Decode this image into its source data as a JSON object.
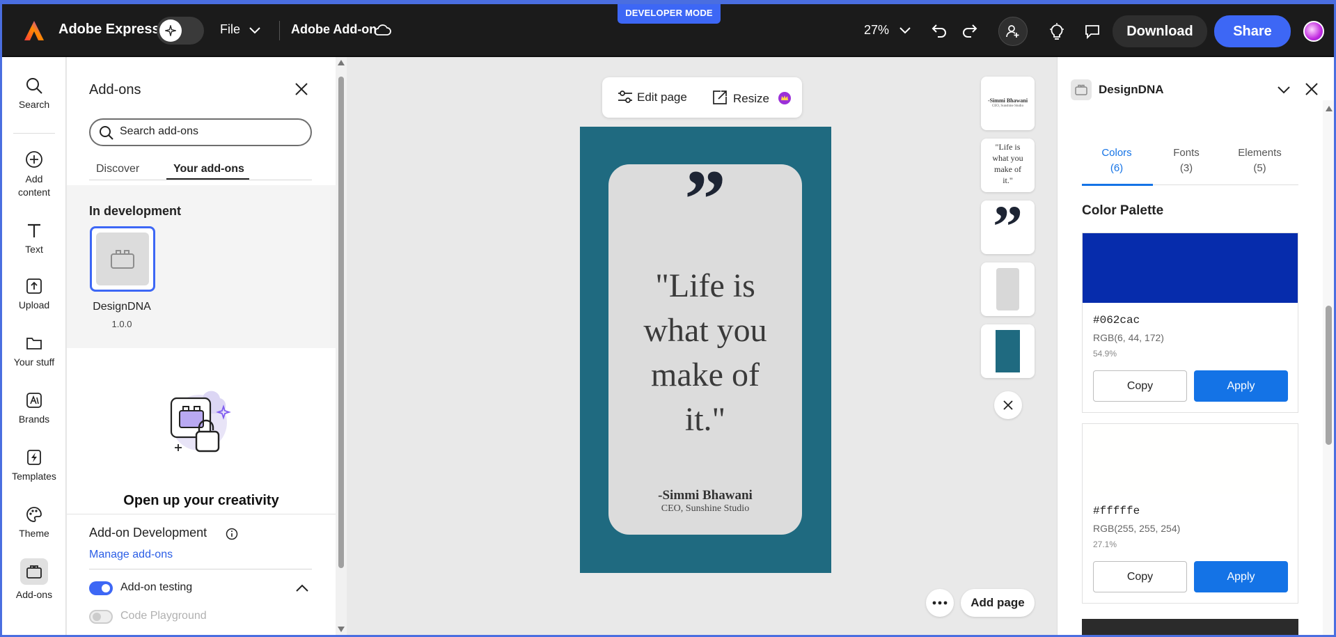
{
  "topbar": {
    "app_name": "Adobe Express",
    "file_menu": "File",
    "doc_title": "Adobe Add-on",
    "developer_badge": "DEVELOPER MODE",
    "zoom": "27%",
    "download_label": "Download",
    "share_label": "Share"
  },
  "rail": {
    "items": [
      {
        "label": "Search"
      },
      {
        "label": "Add content"
      },
      {
        "label": "Text"
      },
      {
        "label": "Upload"
      },
      {
        "label": "Your stuff"
      },
      {
        "label": "Brands"
      },
      {
        "label": "Templates"
      },
      {
        "label": "Theme"
      },
      {
        "label": "Add-ons"
      }
    ]
  },
  "addons": {
    "title": "Add-ons",
    "search_placeholder": "Search add-ons",
    "tabs": [
      "Discover",
      "Your add-ons"
    ],
    "in_dev_heading": "In development",
    "addon_name": "DesignDNA",
    "addon_version": "1.0.0",
    "promo_heading": "Open up your creativity",
    "dev_section_title": "Add-on Development",
    "manage_link": "Manage add-ons",
    "testing_label": "Add-on testing",
    "playground_label": "Code Playground"
  },
  "canvas": {
    "edit_page": "Edit page",
    "resize": "Resize",
    "quote_mark": "”",
    "quote_lines": [
      "\"Life is",
      "what you",
      "make of",
      "it.\""
    ],
    "author": "-Simmi Bhawani",
    "author_title": "CEO, Sunshine Studio",
    "thumbs": {
      "t1_name": "-Simmi Bhawani",
      "t1_sub": "CEO, Sunshine Studio",
      "t2_lines": [
        "\"Life is",
        "what you",
        "make of",
        "it.\""
      ]
    },
    "add_page": "Add page"
  },
  "designdna": {
    "title": "DesignDNA",
    "tabs": [
      {
        "label": "Colors",
        "count": "(6)"
      },
      {
        "label": "Fonts",
        "count": "(3)"
      },
      {
        "label": "Elements",
        "count": "(5)"
      }
    ],
    "palette_heading": "Color Palette",
    "colors": [
      {
        "hex": "#062cac",
        "rgb": "RGB(6, 44, 172)",
        "pct": "54.9%",
        "swatch": "#062cac"
      },
      {
        "hex": "#fffffe",
        "rgb": "RGB(255, 255, 254)",
        "pct": "27.1%",
        "swatch": "#fffffe"
      }
    ],
    "third_swatch": "#2b2b2b",
    "copy_label": "Copy",
    "apply_label": "Apply"
  },
  "colors": {
    "accent": "#3d67f5",
    "apply_blue": "#1473e6",
    "page_teal": "#1f6a80"
  }
}
